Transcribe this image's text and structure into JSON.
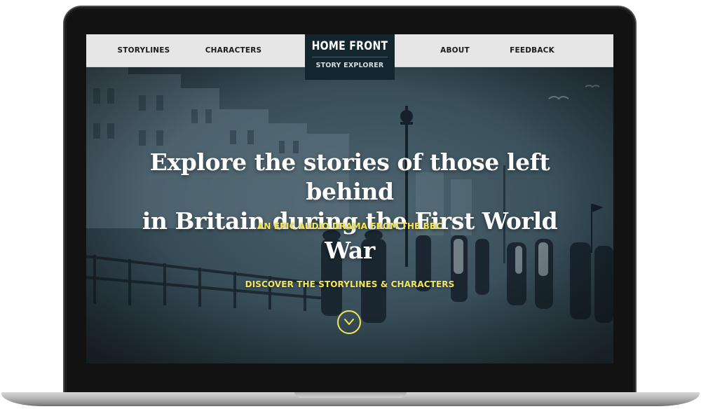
{
  "nav": {
    "left_items": [
      {
        "label": "STORYLINES"
      },
      {
        "label": "CHARACTERS"
      }
    ],
    "right_items": [
      {
        "label": "ABOUT"
      },
      {
        "label": "FEEDBACK"
      }
    ],
    "logo": {
      "title": "HOME FRONT",
      "subtitle": "STORY EXPLORER"
    }
  },
  "hero": {
    "heading_line1": "Explore the stories of those left behind",
    "heading_line2": "in Britain during the First World War",
    "tagline": "AN EPIC AUDIO DRAMA FROM THE BBC",
    "cta": "DISCOVER THE STORYLINES & CHARACTERS",
    "scroll_icon": "chevron-down-icon"
  },
  "colors": {
    "accent_yellow": "#f3e65a",
    "nav_background": "#e6e6e6",
    "logo_background": "#132630",
    "hero_tint": "#3a505b"
  }
}
